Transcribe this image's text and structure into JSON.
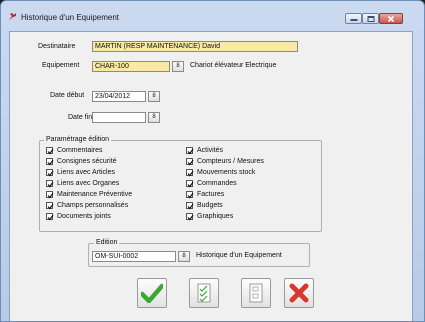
{
  "window": {
    "title": "Historique d'un Equipement"
  },
  "form": {
    "destinataire": {
      "label": "Destinataire",
      "value": "MARTIN (RESP MAINTENANCE) David"
    },
    "equipement": {
      "label": "Equipement",
      "code": "CHAR-100",
      "description": "Chariot élévateur Electrique"
    },
    "date_debut": {
      "label": "Date début",
      "value": "23/04/2012"
    },
    "date_fin": {
      "label": "Date fin",
      "value": ""
    }
  },
  "parametrage": {
    "title": "Paramétrage édition",
    "left": [
      "Commentaires",
      "Consignes sécurité",
      "Liens avec Articles",
      "Liens avec Organes",
      "Maintenance Préventive",
      "Champs personnalisés",
      "Documents joints"
    ],
    "right": [
      "Activités",
      "Compteurs / Mesures",
      "Mouvements stock",
      "Commandes",
      "Factures",
      "Budgets",
      "Graphiques"
    ]
  },
  "edition": {
    "title": "Edition",
    "code": "OM-SUI-0002",
    "description": "Historique d'un Equipement"
  },
  "lookup_glyph": "8",
  "colors": {
    "accent_yellow": "#fbe8a4",
    "ok_green": "#3aa833",
    "cancel_red": "#d8382e"
  }
}
